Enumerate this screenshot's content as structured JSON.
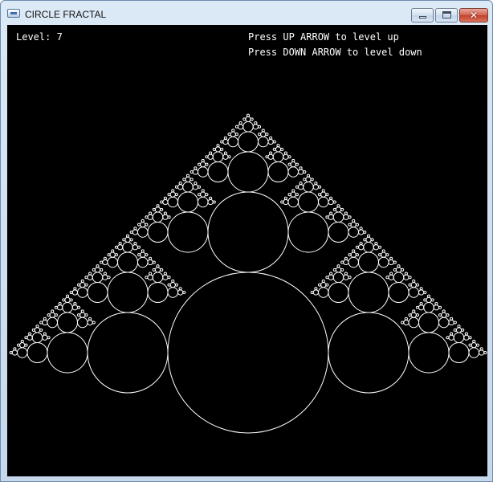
{
  "window": {
    "title": "CIRCLE FRACTAL",
    "icon": "app-window-icon",
    "controls": {
      "minimize_icon": "minimize-icon",
      "maximize_icon": "maximize-icon",
      "close_glyph": "✕"
    }
  },
  "hud": {
    "level_text": "Level: 7",
    "hint_up": "Press UP ARROW to level up",
    "hint_down": "Press DOWN ARROW to level down"
  },
  "fractal": {
    "level": 7,
    "stroke_color": "#ffffff",
    "background_color": "#000000"
  }
}
